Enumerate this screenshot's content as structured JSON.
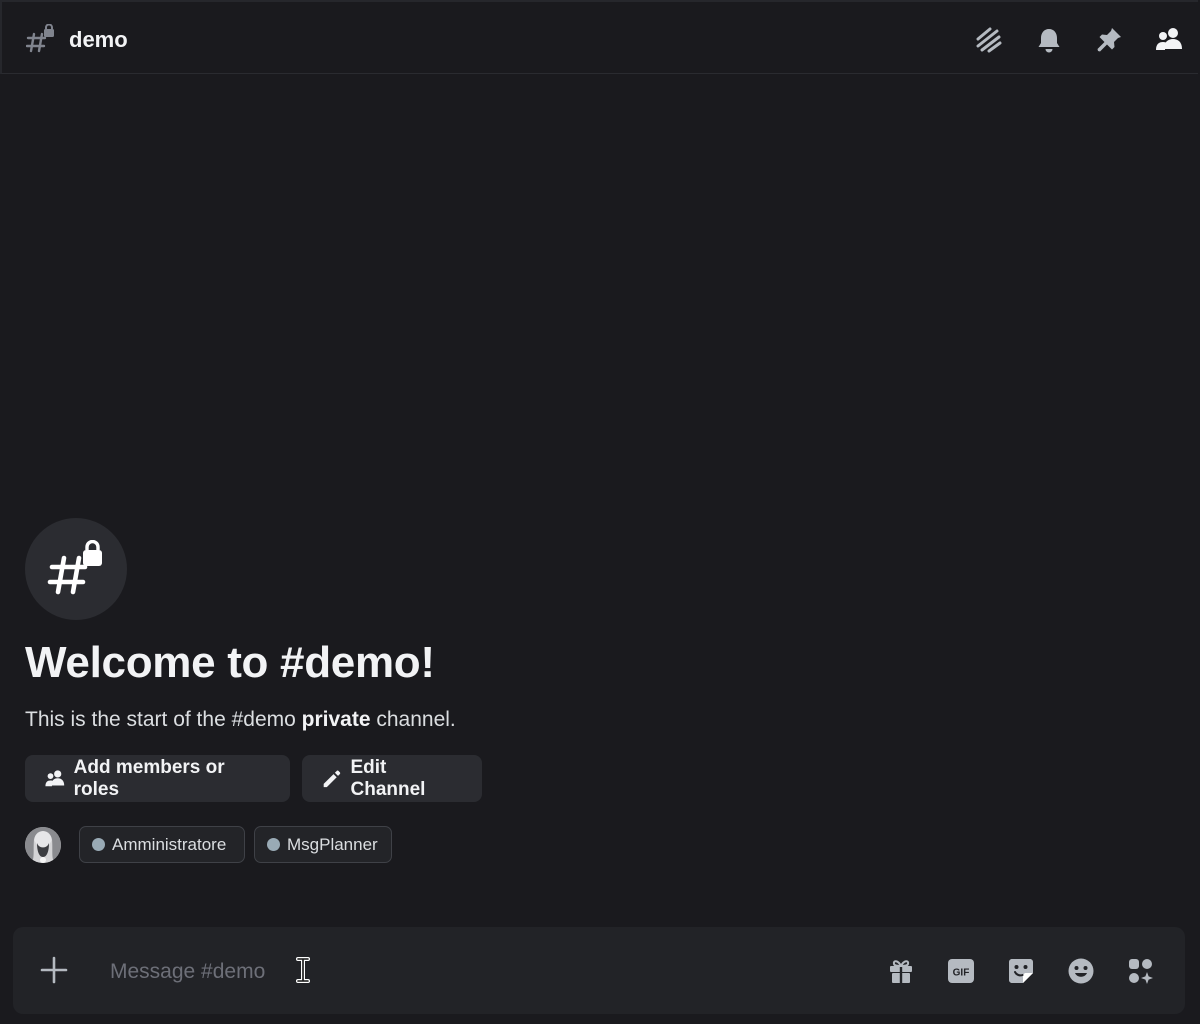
{
  "channel": {
    "name": "demo"
  },
  "header_icons": [
    {
      "name": "threads-icon"
    },
    {
      "name": "bell-icon"
    },
    {
      "name": "pin-icon"
    },
    {
      "name": "member-list-icon"
    }
  ],
  "welcome": {
    "title": "Welcome to #demo!",
    "subtitle_prefix": "This is the start of the #demo ",
    "subtitle_bold": "private",
    "subtitle_suffix": " channel."
  },
  "actions": {
    "add_members_label": "Add members or roles",
    "edit_channel_label": "Edit Channel"
  },
  "roles": [
    {
      "name": "Amministratore",
      "color": "#99aab5"
    },
    {
      "name": "MsgPlanner",
      "color": "#99aab5"
    }
  ],
  "composer": {
    "placeholder": "Message #demo"
  },
  "colors": {
    "background": "#1a1a1e",
    "text": "#dbdee1",
    "icon": "#b5bac1"
  }
}
